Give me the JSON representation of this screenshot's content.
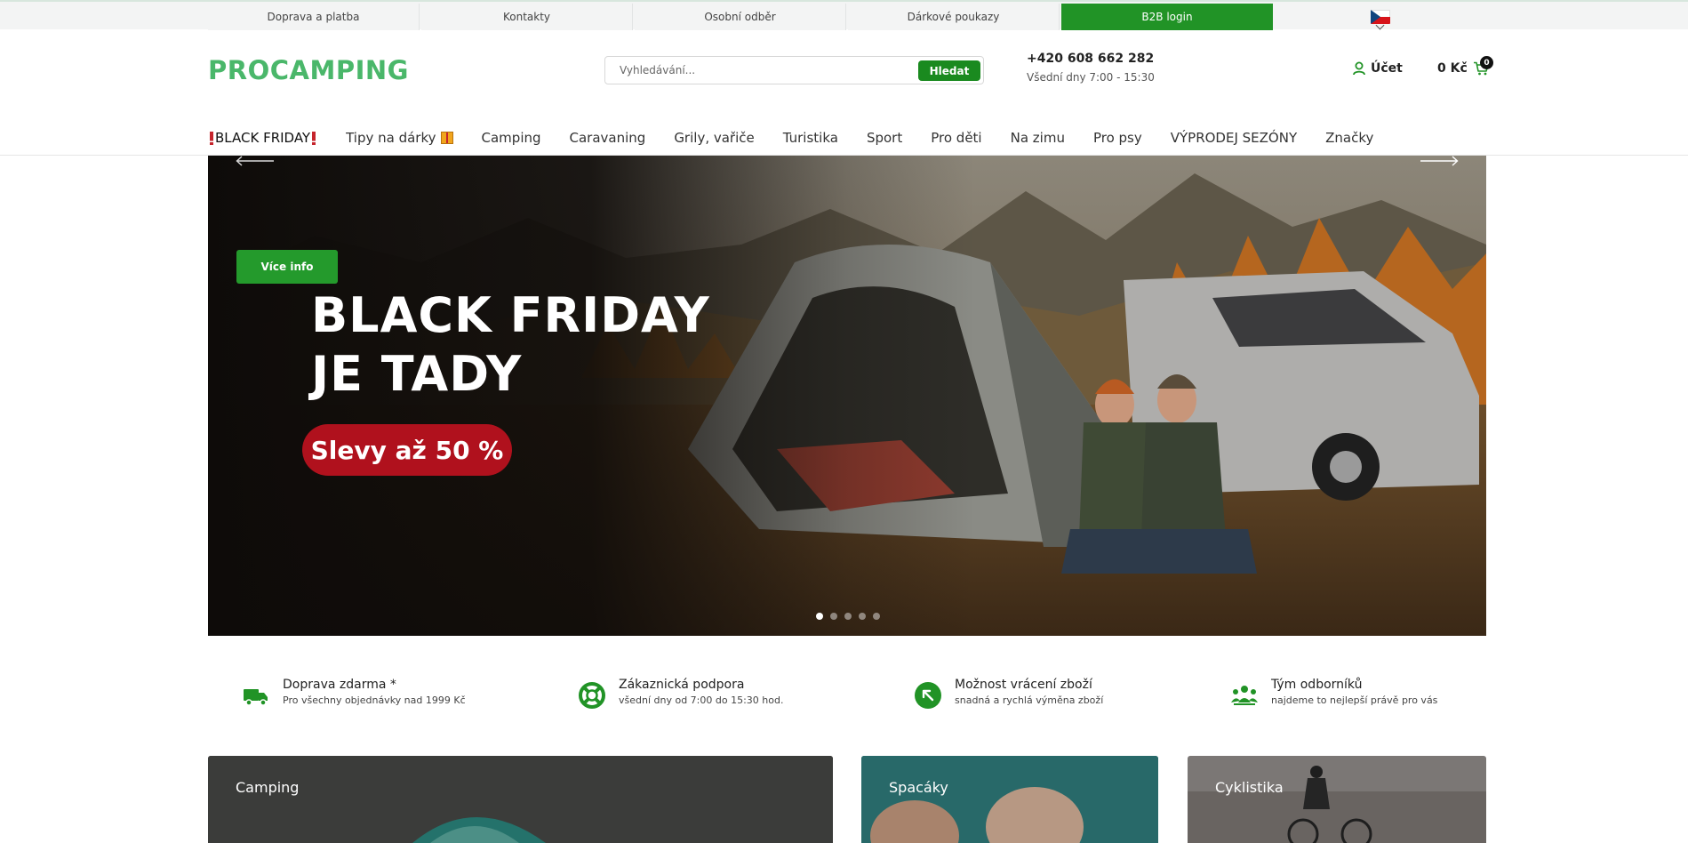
{
  "topbar": {
    "links": [
      "Doprava a platba",
      "Kontakty",
      "Osobní odběr",
      "Dárkové poukazy"
    ],
    "b2b_label": "B2B login",
    "language_flag": "czech-flag-icon"
  },
  "header": {
    "logo_text": "PROCAMPING",
    "search_placeholder": "Vyhledávání...",
    "search_button": "Hledat",
    "phone": "+420 608 662 282",
    "hours": "Všední dny 7:00 - 15:30",
    "account_label": "Účet",
    "cart_total": "0 Kč",
    "cart_count": "0"
  },
  "nav": {
    "items": [
      "BLACK FRIDAY",
      "Tipy na dárky",
      "Camping",
      "Caravaning",
      "Grily, vařiče",
      "Turistika",
      "Sport",
      "Pro děti",
      "Na zimu",
      "Pro psy",
      "VÝPRODEJ SEZÓNY",
      "Značky"
    ]
  },
  "hero": {
    "button_label": "Více info",
    "title_line1": "BLACK FRIDAY",
    "title_line2": "JE TADY",
    "pill_text": "Slevy až 50 %",
    "slide_count": 5,
    "active_slide": 1
  },
  "features": [
    {
      "title": "Doprava zdarma *",
      "subtitle": "Pro všechny objednávky nad 1999 Kč",
      "icon": "truck-icon"
    },
    {
      "title": "Zákaznická podpora",
      "subtitle": "všední dny od 7:00 do 15:30 hod.",
      "icon": "lifebuoy-icon"
    },
    {
      "title": "Možnost vrácení zboží",
      "subtitle": "snadná a rychlá výměna zboží",
      "icon": "return-arrow-icon"
    },
    {
      "title": "Tým odborníků",
      "subtitle": "najdeme to nejlepší právě pro vás",
      "icon": "team-icon"
    }
  ],
  "categories": [
    {
      "label": "Camping"
    },
    {
      "label": "Spacáky"
    },
    {
      "label": "Cyklistika"
    }
  ],
  "colors": {
    "brand_green": "#219326",
    "logo_green": "#4ab76a",
    "sale_red": "#b0111d"
  }
}
